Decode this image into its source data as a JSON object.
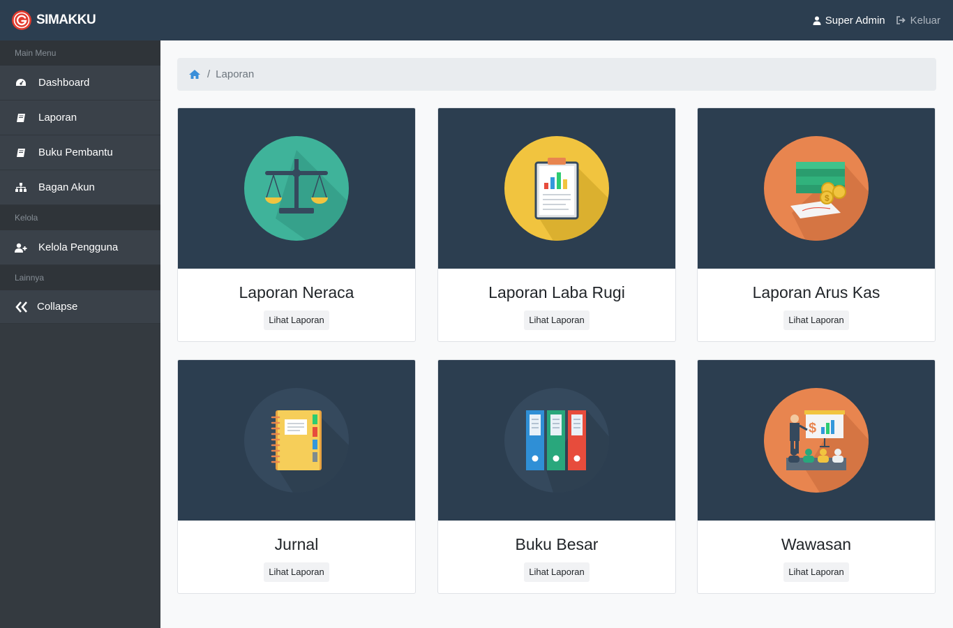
{
  "app": {
    "brand": "SIMAKKU"
  },
  "header": {
    "user_label": "Super Admin",
    "logout_label": "Keluar"
  },
  "sidebar": {
    "sections": [
      {
        "heading": "Main Menu"
      },
      {
        "heading": "Kelola"
      },
      {
        "heading": "Lainnya"
      }
    ],
    "items": [
      {
        "label": "Dashboard",
        "icon": "dashboard-icon"
      },
      {
        "label": "Laporan",
        "icon": "book-icon"
      },
      {
        "label": "Buku Pembantu",
        "icon": "book-icon"
      },
      {
        "label": "Bagan Akun",
        "icon": "sitemap-icon"
      },
      {
        "label": "Kelola Pengguna",
        "icon": "user-plus-icon"
      },
      {
        "label": "Collapse",
        "icon": "double-chevron-left-icon"
      }
    ]
  },
  "breadcrumb": {
    "current": "Laporan",
    "home_icon": "home-icon"
  },
  "cards": [
    {
      "title": "Laporan Neraca",
      "button": "Lihat Laporan",
      "icon": "balance-scale-icon",
      "circle_color": "#3fb39a"
    },
    {
      "title": "Laporan Laba Rugi",
      "button": "Lihat Laporan",
      "icon": "clipboard-chart-icon",
      "circle_color": "#f1c43f"
    },
    {
      "title": "Laporan Arus Kas",
      "button": "Lihat Laporan",
      "icon": "money-coins-icon",
      "circle_color": "#e8854f"
    },
    {
      "title": "Jurnal",
      "button": "Lihat Laporan",
      "icon": "notebook-icon",
      "circle_color": "#35495d"
    },
    {
      "title": "Buku Besar",
      "button": "Lihat Laporan",
      "icon": "binders-icon",
      "circle_color": "#35495d"
    },
    {
      "title": "Wawasan",
      "button": "Lihat Laporan",
      "icon": "presentation-icon",
      "circle_color": "#e8854f"
    }
  ],
  "colors": {
    "topbar": "#2c3e50",
    "sidebar": "#343a40",
    "accent": "#3a8fd9"
  }
}
